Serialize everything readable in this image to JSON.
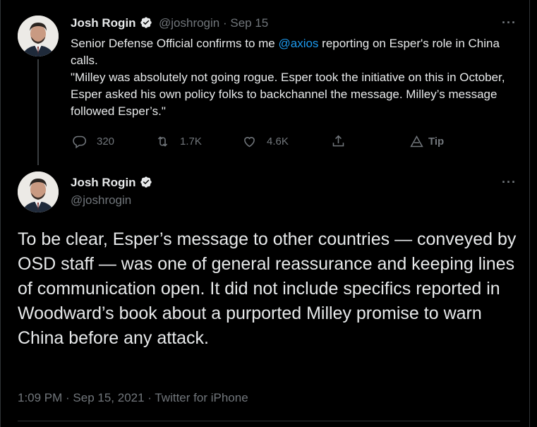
{
  "tweet1": {
    "name": "Josh Rogin",
    "handle": "@joshrogin",
    "separator": " · ",
    "date": "Sep 15",
    "text_line1_pre": "Senior Defense Official confirms to me ",
    "mention": "@axios",
    "text_line1_post": " reporting on Esper's role in China calls.",
    "text_para2": "\"Milley was absolutely not going rogue. Esper took the initiative on this in October, Esper asked his own policy folks to backchannel the message. Milley’s message followed Esper’s.\"",
    "replies": "320",
    "retweets": "1.7K",
    "likes": "4.6K",
    "tip": "Tip",
    "more": "···"
  },
  "tweet2": {
    "name": "Josh Rogin",
    "handle": "@joshrogin",
    "more": "···",
    "text": "To be clear, Esper’s message to other countries — conveyed by OSD staff — was one of general reassurance and keeping lines of communication open. It did not include specifics reported in Woodward’s book about a purported Milley promise to warn China before any attack.",
    "timestamp": "1:09 PM · Sep 15, 2021 · Twitter for iPhone"
  },
  "colors": {
    "background": "#000000",
    "accent": "#1d9bf0",
    "secondary_text": "#71767b"
  }
}
